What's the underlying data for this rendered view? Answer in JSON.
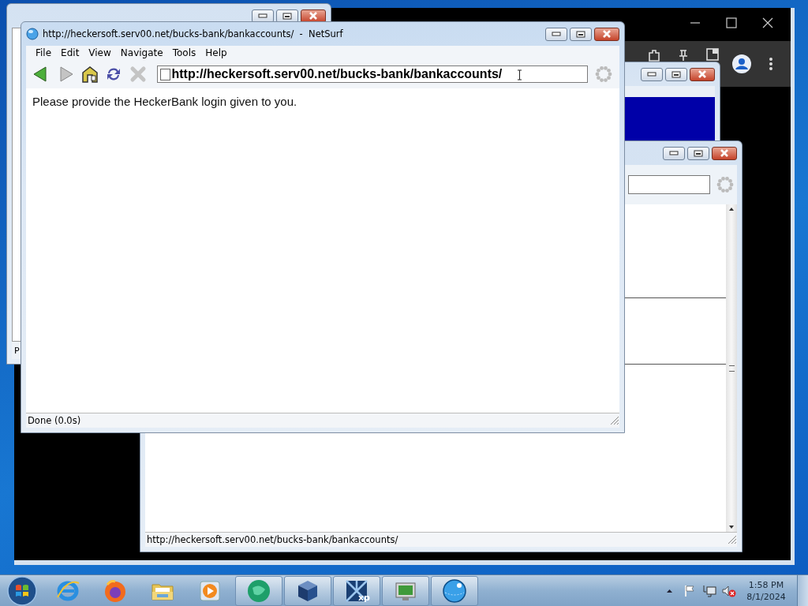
{
  "left_window": {
    "status_fragment": "P"
  },
  "main_window": {
    "title": "http://heckersoft.serv00.net/bucks-bank/bankaccounts/  -  NetSurf",
    "menu": [
      "File",
      "Edit",
      "View",
      "Navigate",
      "Tools",
      "Help"
    ],
    "toolbar": [
      {
        "kind": "back",
        "disabled": false
      },
      {
        "kind": "forward",
        "disabled": true
      },
      {
        "kind": "home",
        "disabled": false
      },
      {
        "kind": "reload",
        "disabled": false
      },
      {
        "kind": "stop",
        "disabled": true
      }
    ],
    "address": "http://heckersoft.serv00.net/bucks-bank/bankaccounts/",
    "content": "Please provide the HeckerBank login given to you.",
    "status": "Done (0.0s)"
  },
  "back_window": {
    "status": "http://heckersoft.serv00.net/bucks-bank/bankaccounts/"
  },
  "taskbar": {
    "apps": [
      {
        "kind": "ie",
        "running": false
      },
      {
        "kind": "firefox",
        "running": false
      },
      {
        "kind": "folder",
        "running": false
      },
      {
        "kind": "media",
        "running": false
      },
      {
        "kind": "sphere",
        "running": true
      },
      {
        "kind": "cube",
        "running": true
      },
      {
        "kind": "xp",
        "running": true,
        "label": "xp"
      },
      {
        "kind": "monitor",
        "running": true
      },
      {
        "kind": "globe",
        "running": true
      }
    ],
    "time": "1:58 PM",
    "date": "8/1/2024"
  }
}
